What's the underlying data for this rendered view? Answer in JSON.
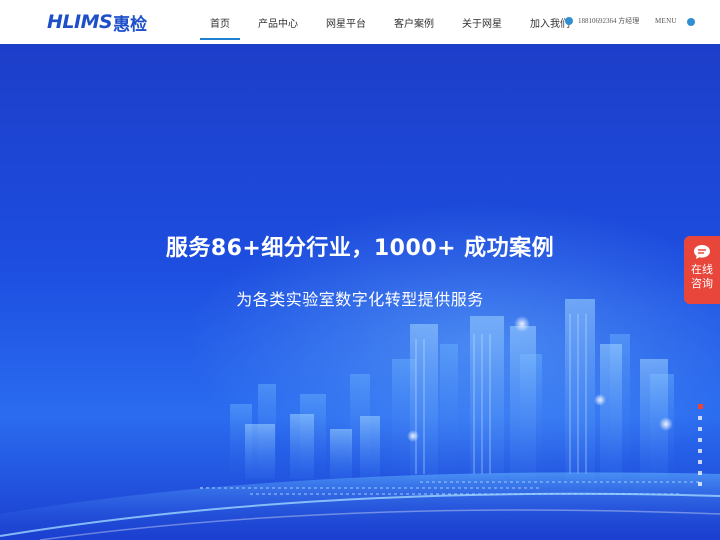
{
  "header": {
    "logo_latin": "HLIMS",
    "logo_cn": "惠检",
    "nav": [
      {
        "label": "首页",
        "active": true
      },
      {
        "label": "产品中心",
        "active": false
      },
      {
        "label": "网星平台",
        "active": false
      },
      {
        "label": "客户案例",
        "active": false
      },
      {
        "label": "关于网星",
        "active": false
      },
      {
        "label": "加入我们",
        "active": false
      }
    ],
    "contact": "18810692364 方经理",
    "menu_label": "MENU"
  },
  "hero": {
    "title": "服务86+细分行业，1000+ 成功案例",
    "subtitle": "为各类实验室数字化转型提供服务"
  },
  "consult": {
    "label": "在线咨询",
    "icon": "chat-bubble-icon",
    "color": "#e9463b"
  },
  "colors": {
    "brand": "#1d4fc9",
    "accent": "#1f7fd0",
    "hero_bg": "#1d4ee0"
  },
  "pager": {
    "count": 8,
    "active_index": 0
  }
}
